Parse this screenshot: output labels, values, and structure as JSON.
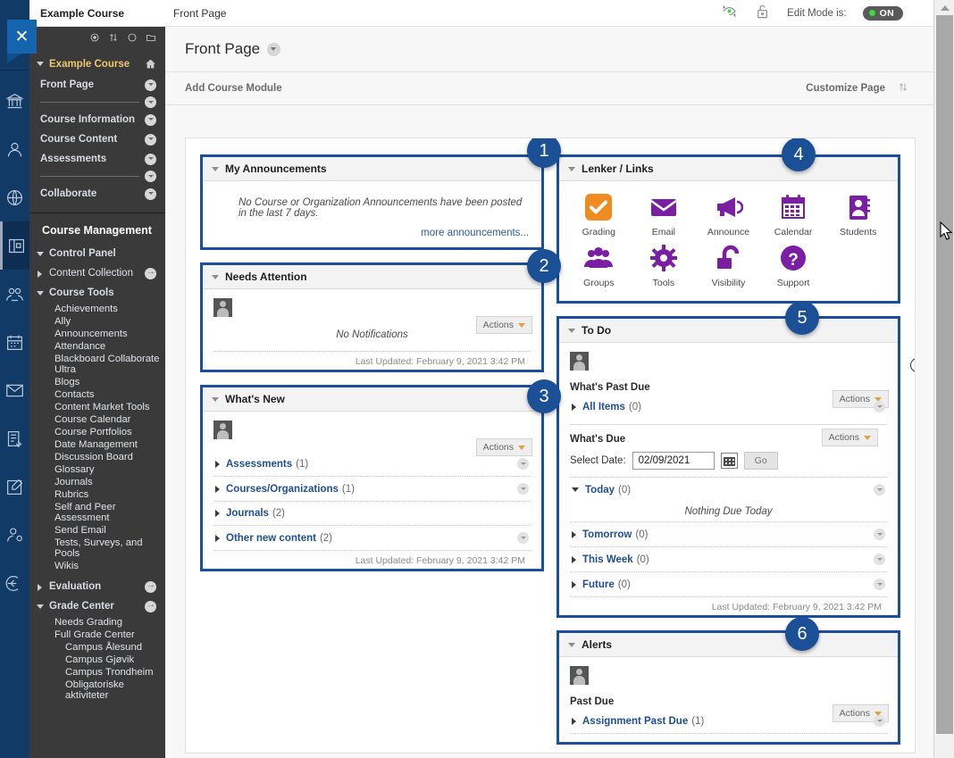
{
  "topbar": {
    "course_crumb": "Example Course",
    "page_crumb": "Front Page",
    "refresh_icon": "refresh-eye-icon",
    "lock_icon": "unlock-icon",
    "edit_mode_label": "Edit Mode is:",
    "edit_mode_state": "ON"
  },
  "rail": {
    "close_icon": "close-icon",
    "items": [
      {
        "icon": "institution-icon",
        "active": false
      },
      {
        "icon": "person-icon",
        "active": false
      },
      {
        "icon": "globe-icon",
        "active": false
      },
      {
        "icon": "courses-icon",
        "active": true
      },
      {
        "icon": "groups-icon",
        "active": false
      },
      {
        "icon": "calendar-icon",
        "active": false
      },
      {
        "icon": "mail-icon",
        "active": false
      },
      {
        "icon": "grades-icon",
        "active": false
      },
      {
        "icon": "edit-icon",
        "active": false
      },
      {
        "icon": "profile-settings-icon",
        "active": false
      },
      {
        "icon": "logout-icon",
        "active": false
      }
    ]
  },
  "coursemenu": {
    "tool_icons": [
      "target-icon",
      "reorder-icon",
      "refresh-circle-icon",
      "folder-icon"
    ],
    "course_title": "Example Course",
    "home_icon": "home-icon",
    "items": [
      {
        "label": "Front Page",
        "type": "link"
      },
      {
        "label": "",
        "type": "divider"
      },
      {
        "label": "Course Information",
        "type": "link"
      },
      {
        "label": "Course Content",
        "type": "link"
      },
      {
        "label": "Assessments",
        "type": "link"
      },
      {
        "label": "",
        "type": "divider"
      },
      {
        "label": "Collaborate",
        "type": "link"
      }
    ],
    "management_title": "Course Management",
    "control_panel": "Control Panel",
    "content_collection": "Content Collection",
    "course_tools": "Course Tools",
    "tools": [
      "Achievements",
      "Ally",
      "Announcements",
      "Attendance",
      "Blackboard Collaborate Ultra",
      "Blogs",
      "Contacts",
      "Content Market Tools",
      "Course Calendar",
      "Course Portfolios",
      "Date Management",
      "Discussion Board",
      "Glossary",
      "Journals",
      "Rubrics",
      "Self and Peer Assessment",
      "Send Email",
      "Tests, Surveys, and Pools",
      "Wikis"
    ],
    "evaluation": "Evaluation",
    "grade_center": "Grade Center",
    "grade_items": [
      {
        "label": "Needs Grading",
        "indent": false
      },
      {
        "label": "Full Grade Center",
        "indent": false
      },
      {
        "label": "Campus Ålesund",
        "indent": true
      },
      {
        "label": "Campus Gjøvik",
        "indent": true
      },
      {
        "label": "Campus Trondheim",
        "indent": true
      },
      {
        "label": "Obligatoriske aktiviteter",
        "indent": true
      }
    ]
  },
  "page": {
    "title": "Front Page",
    "add_module_label": "Add Course Module",
    "customize_label": "Customize Page",
    "reorder_icon": "reorder-icon",
    "help_icon": "help-question-icon"
  },
  "modules": {
    "announcements": {
      "badge": "1",
      "title": "My Announcements",
      "empty_text": "No Course or Organization Announcements have been posted in the last 7 days.",
      "more_link": "more announcements..."
    },
    "needs_attention": {
      "badge": "2",
      "title": "Needs Attention",
      "actions_label": "Actions",
      "empty_text": "No Notifications",
      "footer": "Last Updated: February 9, 2021 3:42 PM"
    },
    "whats_new": {
      "badge": "3",
      "title": "What's New",
      "actions_label": "Actions",
      "rows": [
        {
          "label": "Assessments",
          "count": "(1)",
          "chevron": true
        },
        {
          "label": "Courses/Organizations",
          "count": "(1)",
          "chevron": true
        },
        {
          "label": "Journals",
          "count": "(2)",
          "chevron": false
        },
        {
          "label": "Other new content",
          "count": "(2)",
          "chevron": true
        }
      ],
      "footer": "Last Updated: February 9, 2021 3:42 PM"
    },
    "links": {
      "badge": "4",
      "title": "Lenker / Links",
      "tiles": [
        {
          "label": "Grading",
          "icon": "check-square-icon",
          "color": "#f08c1f"
        },
        {
          "label": "Email",
          "icon": "envelope-icon",
          "color": "#7a1fa2"
        },
        {
          "label": "Announce",
          "icon": "megaphone-icon",
          "color": "#7a1fa2"
        },
        {
          "label": "Calendar",
          "icon": "calendar-icon",
          "color": "#7a1fa2"
        },
        {
          "label": "Students",
          "icon": "address-book-icon",
          "color": "#7a1fa2"
        },
        {
          "label": "Groups",
          "icon": "people-group-icon",
          "color": "#7a1fa2"
        },
        {
          "label": "Tools",
          "icon": "gear-icon",
          "color": "#7a1fa2"
        },
        {
          "label": "Visibility",
          "icon": "unlock-icon",
          "color": "#7a1fa2"
        },
        {
          "label": "Support",
          "icon": "question-circle-icon",
          "color": "#7a1fa2"
        }
      ]
    },
    "todo": {
      "badge": "5",
      "title": "To Do",
      "past_due_title": "What's Past Due",
      "past_due_actions": "Actions",
      "all_items_label": "All Items",
      "all_items_count": "(0)",
      "due_title": "What's Due",
      "due_actions": "Actions",
      "select_date_label": "Select Date:",
      "date_value": "02/09/2021",
      "calendar_icon": "calendar-picker-icon",
      "go_label": "Go",
      "today_label": "Today",
      "today_count": "(0)",
      "nothing_due": "Nothing Due Today",
      "rows": [
        {
          "label": "Tomorrow",
          "count": "(0)"
        },
        {
          "label": "This Week",
          "count": "(0)"
        },
        {
          "label": "Future",
          "count": "(0)"
        }
      ],
      "footer": "Last Updated: February 9, 2021 3:42 PM"
    },
    "alerts": {
      "badge": "6",
      "title": "Alerts",
      "actions_label": "Actions",
      "past_due_title": "Past Due",
      "row_label": "Assignment Past Due",
      "row_count": "(1)"
    }
  }
}
